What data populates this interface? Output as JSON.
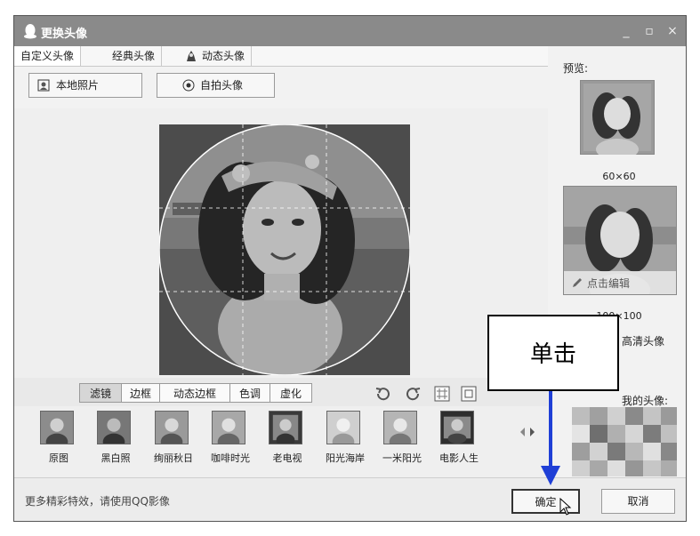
{
  "window": {
    "title": "更换头像"
  },
  "tabs": [
    {
      "label": "自定义头像"
    },
    {
      "label": "经典头像"
    },
    {
      "label": "动态头像"
    }
  ],
  "source_buttons": {
    "local": "本地照片",
    "selfie": "自拍头像"
  },
  "editor_toolbar": {
    "tabs": [
      {
        "label": "滤镜"
      },
      {
        "label": "边框"
      },
      {
        "label": "动态边框"
      },
      {
        "label": "色调"
      },
      {
        "label": "虚化"
      }
    ],
    "icons": [
      "undo-icon",
      "redo-icon",
      "grid-icon",
      "crop-icon"
    ]
  },
  "filters": [
    {
      "label": "原图"
    },
    {
      "label": "黑白照"
    },
    {
      "label": "绚丽秋日"
    },
    {
      "label": "咖啡时光"
    },
    {
      "label": "老电视"
    },
    {
      "label": "阳光海岸"
    },
    {
      "label": "一米阳光"
    },
    {
      "label": "电影人生"
    }
  ],
  "preview": {
    "label": "预览:",
    "small_size": "60×60",
    "large_size": "100×100",
    "edit_label": "点击编辑",
    "hd_label": "高清头像",
    "history_label": "我的头像:"
  },
  "footer": {
    "hint": "更多精彩特效，请使用QQ影像",
    "ok": "确定",
    "cancel": "取消"
  },
  "callout": {
    "text": "单击"
  },
  "colors": {
    "title_bar": "#8a8a8a",
    "annotation_arrow": "#1f3fd6"
  }
}
